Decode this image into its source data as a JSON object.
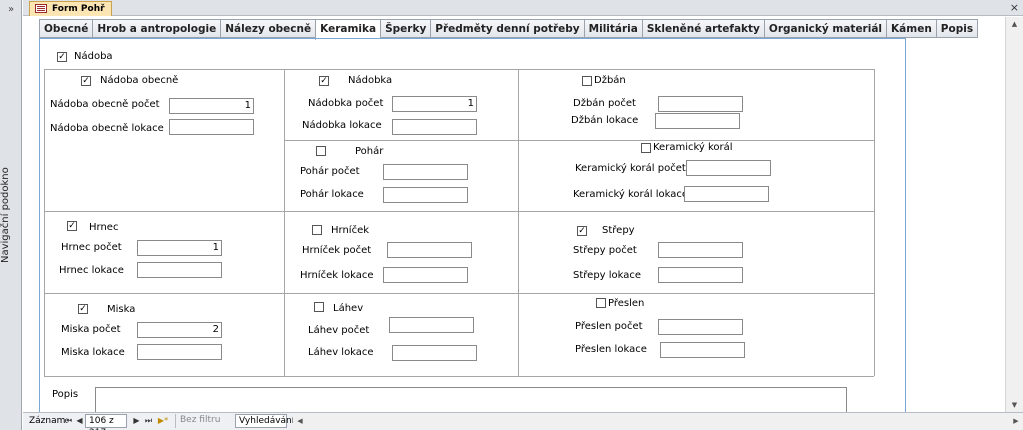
{
  "navigation": {
    "toggle": "»",
    "label": "Navigační podokno"
  },
  "document": {
    "tab_title": "Form Pohř",
    "close": "×"
  },
  "tabs": [
    {
      "label": "Obecné",
      "active": false
    },
    {
      "label": "Hrob a antropologie",
      "active": false
    },
    {
      "label": "Nálezy obecně",
      "active": false
    },
    {
      "label": "Keramika",
      "active": true
    },
    {
      "label": "Šperky",
      "active": false
    },
    {
      "label": "Předměty denní potřeby",
      "active": false
    },
    {
      "label": "Militária",
      "active": false
    },
    {
      "label": "Skleněné artefakty",
      "active": false
    },
    {
      "label": "Organický materiál",
      "active": false
    },
    {
      "label": "Kámen",
      "active": false
    },
    {
      "label": "Popis",
      "active": false
    }
  ],
  "form": {
    "nadoba": {
      "label": "Nádoba",
      "checked": true
    },
    "nadoba_obecne": {
      "label": "Nádoba obecně",
      "checked": true,
      "count_label": "Nádoba obecně počet",
      "count_value": "1",
      "loc_label": "Nádoba obecně lokace",
      "loc_value": ""
    },
    "nadobka": {
      "label": "Nádobka",
      "checked": true,
      "count_label": "Nádobka počet",
      "count_value": "1",
      "loc_label": "Nádobka lokace",
      "loc_value": ""
    },
    "dzban": {
      "label": "Džbán",
      "checked": false,
      "count_label": "Džbán počet",
      "count_value": "",
      "loc_label": "Džbán lokace",
      "loc_value": ""
    },
    "pohar": {
      "label": "Pohár",
      "checked": false,
      "count_label": "Pohár počet",
      "count_value": "",
      "loc_label": "Pohár lokace",
      "loc_value": ""
    },
    "keramicky_koral": {
      "label": "Keramický korál",
      "checked": false,
      "count_label": "Keramický korál počet",
      "count_value": "",
      "loc_label": "Keramický korál lokace",
      "loc_value": ""
    },
    "hrnec": {
      "label": "Hrnec",
      "checked": true,
      "count_label": "Hrnec počet",
      "count_value": "1",
      "loc_label": "Hrnec lokace",
      "loc_value": ""
    },
    "hrnicek": {
      "label": "Hrníček",
      "checked": false,
      "count_label": "Hrníček počet",
      "count_value": "",
      "loc_label": "Hrníček lokace",
      "loc_value": ""
    },
    "strepy": {
      "label": "Střepy",
      "checked": true,
      "count_label": "Střepy počet",
      "count_value": "",
      "loc_label": "Střepy lokace",
      "loc_value": ""
    },
    "miska": {
      "label": "Miska",
      "checked": true,
      "count_label": "Miska počet",
      "count_value": "2",
      "loc_label": "Miska lokace",
      "loc_value": ""
    },
    "lahev": {
      "label": "Láhev",
      "checked": false,
      "count_label": "Láhev počet",
      "count_value": "",
      "loc_label": "Láhev lokace",
      "loc_value": ""
    },
    "preslen": {
      "label": "Přeslen",
      "checked": false,
      "count_label": "Přeslen počet",
      "count_value": "",
      "loc_label": "Přeslen lokace",
      "loc_value": ""
    },
    "popis": {
      "label": "Popis",
      "value": ""
    }
  },
  "statusbar": {
    "record_label": "Záznam:",
    "record_value": "106 z 217",
    "first": "⏮",
    "prev": "◀",
    "next": "▶",
    "last": "⏭",
    "new": "▶*",
    "filter": "Bez filtru",
    "search": "Vyhledávání"
  },
  "colors": {
    "active_doc_tab": "#fbe5b3",
    "tab_page_border": "#7aa7d6"
  }
}
